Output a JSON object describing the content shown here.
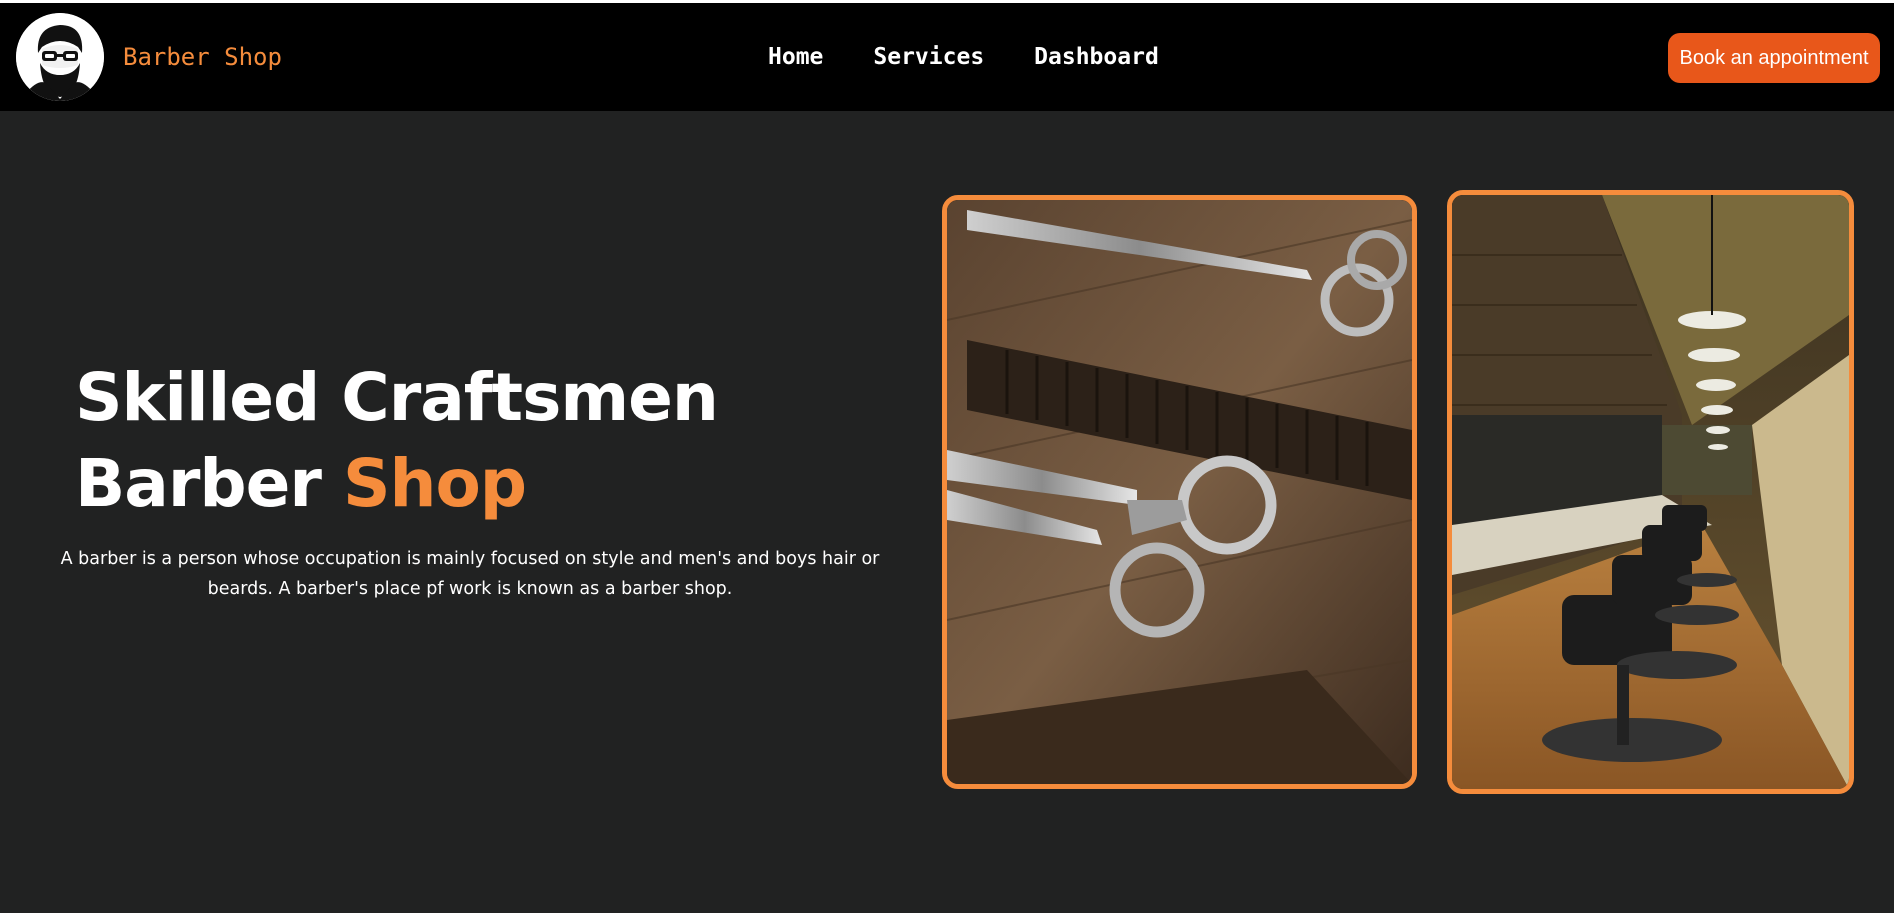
{
  "navbar": {
    "logo_icon": "bearded-man-glasses-logo",
    "brand": "Barber Shop",
    "links": [
      {
        "label": "Home"
      },
      {
        "label": "Services"
      },
      {
        "label": "Dashboard"
      }
    ],
    "cta_label": "Book an appointment"
  },
  "hero": {
    "title_line1": "Skilled Craftsmen",
    "title_line2_word1": "Barber",
    "title_line2_accent": "Shop",
    "description": "A barber is a person whose occupation is mainly focused on style and men's and boys hair or beards. A barber's place pf work is known as a barber shop."
  },
  "images": [
    {
      "icon": "scissors-and-comb-photo"
    },
    {
      "icon": "barbershop-interior-photo"
    }
  ],
  "colors": {
    "accent": "#f58c3c",
    "button": "#e8571a",
    "navbar_bg": "#000000",
    "page_bg": "#212222",
    "text": "#ffffff"
  }
}
